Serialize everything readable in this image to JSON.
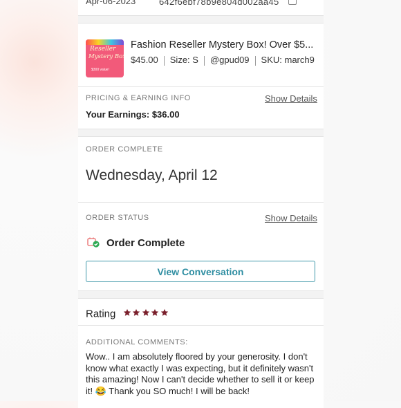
{
  "header": {
    "date": "Apr-06-2023",
    "order_id": "642f6ebf78b9e804d002aa45",
    "copy_icon": "copy-icon"
  },
  "item": {
    "title": "Fashion Reseller Mystery Box! Over $5...",
    "price": "$45.00",
    "size": "Size: S",
    "seller": "@gpud09",
    "sku": "SKU: march9",
    "thumb_line1": "Reseller",
    "thumb_line2": "Mystery Box",
    "thumb_small": "$300 value!",
    "thumb_color": "#f25a7a"
  },
  "pricing": {
    "label": "PRICING & EARNING INFO",
    "link": "Show Details",
    "earnings": "Your Earnings: $36.00"
  },
  "order_complete": {
    "label": "ORDER COMPLETE",
    "date": "Wednesday, April 12"
  },
  "order_status": {
    "label": "ORDER STATUS",
    "link": "Show Details",
    "status": "Order Complete",
    "status_icon": "order-complete-icon",
    "button": "View Conversation",
    "accent": "#3c96a8"
  },
  "rating": {
    "label": "Rating",
    "stars": 5,
    "star_color": "#7a1f2b"
  },
  "comments": {
    "label": "ADDITIONAL COMMENTS:",
    "text": "Wow.. I am absolutely floored by your generosity. I don't know what exactly I was expecting, but it definitely wasn't this amazing! Now I can't decide whether to sell it or keep it! 😂 Thank you SO much! I will be back!"
  }
}
